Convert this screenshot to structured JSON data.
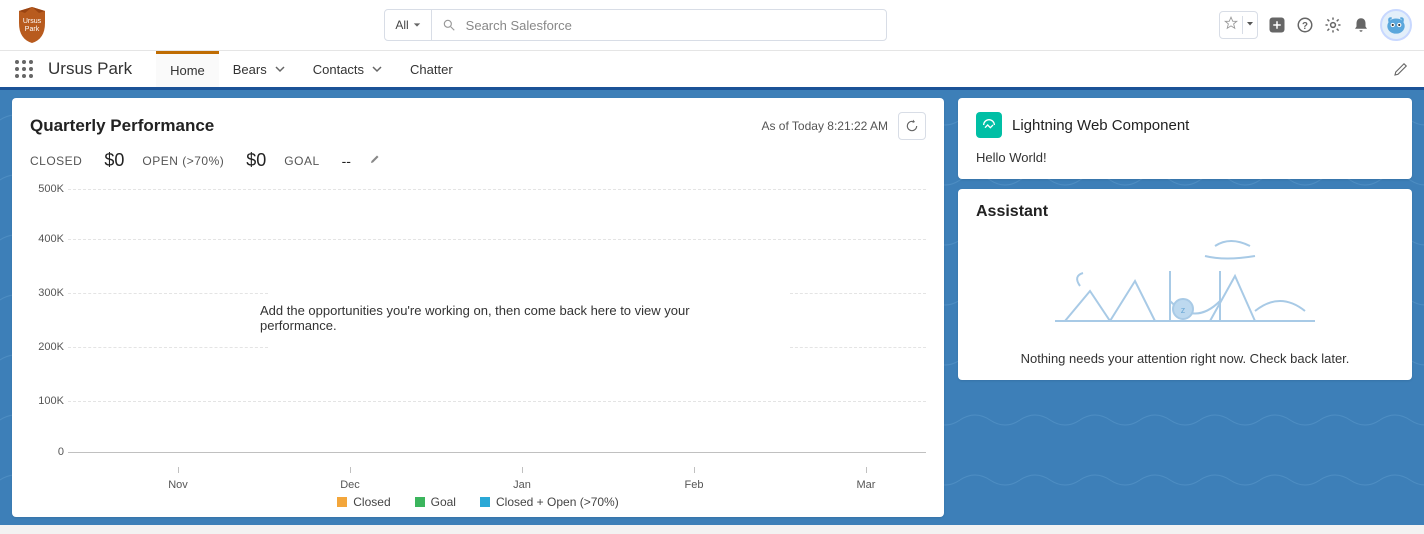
{
  "header": {
    "app_logo_text": "Ursus Park",
    "search_scope": "All",
    "search_placeholder": "Search Salesforce"
  },
  "nav": {
    "app_name": "Ursus Park",
    "items": [
      {
        "label": "Home",
        "active": true,
        "has_dd": false
      },
      {
        "label": "Bears",
        "active": false,
        "has_dd": true
      },
      {
        "label": "Contacts",
        "active": false,
        "has_dd": true
      },
      {
        "label": "Chatter",
        "active": false,
        "has_dd": false
      }
    ]
  },
  "quarterly": {
    "title": "Quarterly Performance",
    "asof": "As of Today 8:21:22 AM",
    "stats": {
      "closed_label": "CLOSED",
      "closed_value": "$0",
      "open_label": "OPEN (>70%)",
      "open_value": "$0",
      "goal_label": "GOAL",
      "goal_value": "--"
    },
    "empty_msg": "Add the opportunities you're working on, then come back here to view your performance."
  },
  "chart_data": {
    "type": "line",
    "categories": [
      "Nov",
      "Dec",
      "Jan",
      "Feb",
      "Mar"
    ],
    "series": [
      {
        "name": "Closed",
        "color": "#f3a63b",
        "values": [
          null,
          null,
          null,
          null,
          null
        ]
      },
      {
        "name": "Goal",
        "color": "#3bb55d",
        "values": [
          null,
          null,
          null,
          null,
          null
        ]
      },
      {
        "name": "Closed + Open (>70%)",
        "color": "#2aa8d6",
        "values": [
          null,
          null,
          null,
          null,
          null
        ]
      }
    ],
    "title": "Quarterly Performance",
    "xlabel": "",
    "ylabel": "",
    "ylim": [
      0,
      500000
    ],
    "yticks": [
      "0",
      "100K",
      "200K",
      "300K",
      "400K",
      "500K"
    ]
  },
  "lwc": {
    "title": "Lightning Web Component",
    "body": "Hello World!"
  },
  "assistant": {
    "title": "Assistant",
    "message": "Nothing needs your attention right now. Check back later."
  }
}
